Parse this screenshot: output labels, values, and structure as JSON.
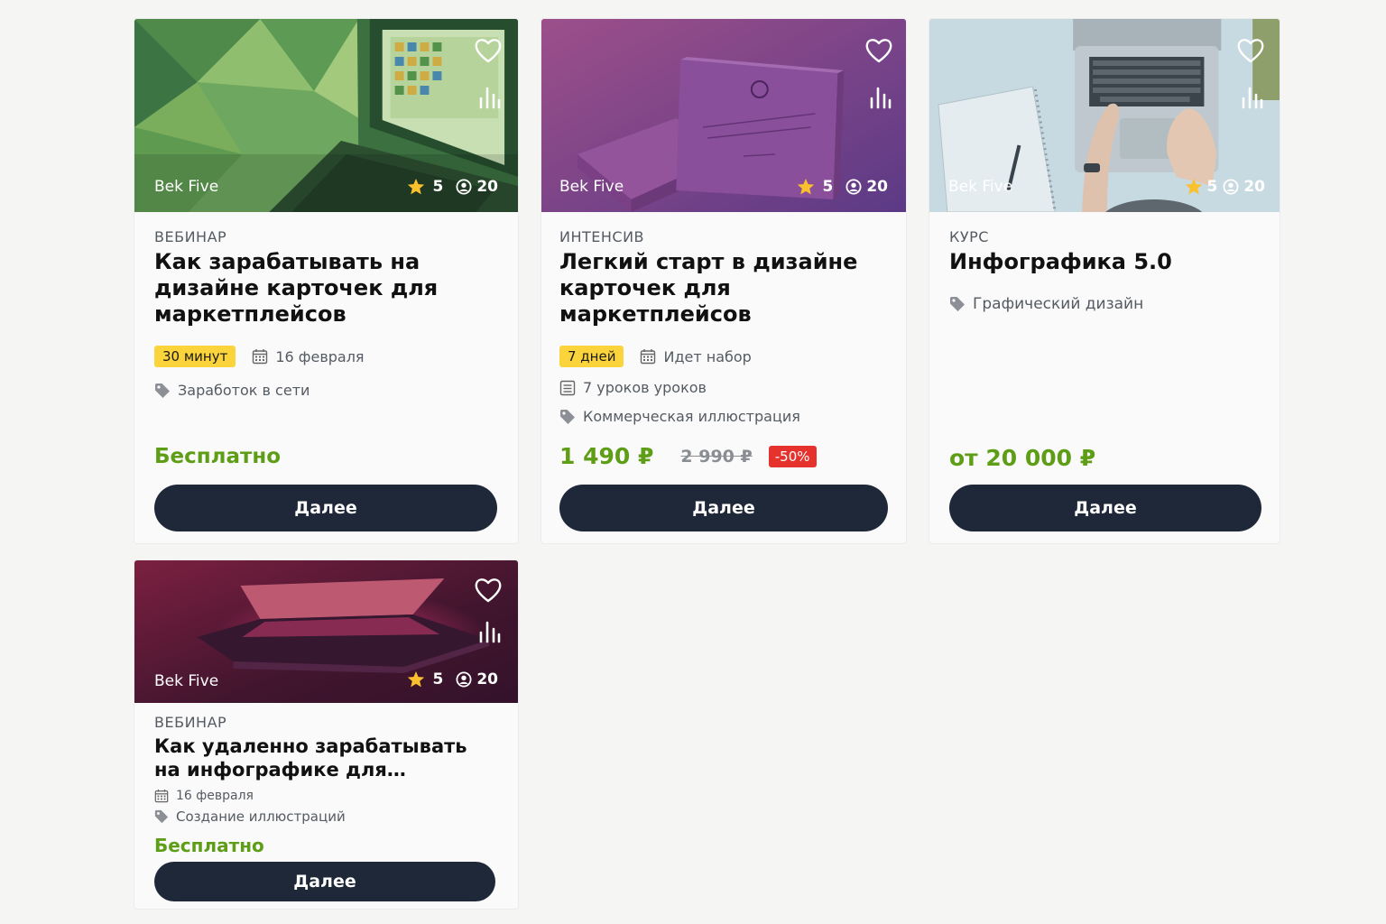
{
  "cards": [
    {
      "author": "Bek Five",
      "rating": "5",
      "students": "20",
      "kind": "ВЕБИНАР",
      "title": "Как зарабатывать на дизайне карточек для маркетплейсов",
      "duration": "30 минут",
      "date": "16 февраля",
      "tag": "Заработок в сети",
      "price": "Бесплатно",
      "button": "Далее"
    },
    {
      "author": "Bek Five",
      "rating": "5",
      "students": "20",
      "kind": "ИНТЕНСИВ",
      "title": "Легкий старт в дизайне карточек для маркетплейсов",
      "duration": "7 дней",
      "date": "Идет набор",
      "lessons": "7 уроков уроков",
      "tag": "Коммерческая иллюстрация",
      "price": "1 490 ₽",
      "old_price": "2 990 ₽",
      "discount": "-50%",
      "button": "Далее"
    },
    {
      "author": "Bek Five",
      "rating": "5",
      "students": "20",
      "kind": "КУРС",
      "title": "Инфографика 5.0",
      "tag": "Графический дизайн",
      "price": "от 20 000 ₽",
      "button": "Далее"
    },
    {
      "author": "Bek Five",
      "rating": "5",
      "students": "20",
      "kind": "ВЕБИНАР",
      "title": "Как удаленно зарабатывать на инфографике для…",
      "date": "16 февраля",
      "tag": "Создание иллюстраций",
      "price": "Бесплатно",
      "button": "Далее"
    }
  ],
  "colors": {
    "price_green": "#5e9e17",
    "button_dark": "#1e2838",
    "badge_yellow": "#fbd33b",
    "discount_red": "#e5322d"
  },
  "icons": [
    "heart-icon",
    "stats-icon",
    "star-icon",
    "user-icon",
    "calendar-icon",
    "tag-icon",
    "list-icon"
  ]
}
